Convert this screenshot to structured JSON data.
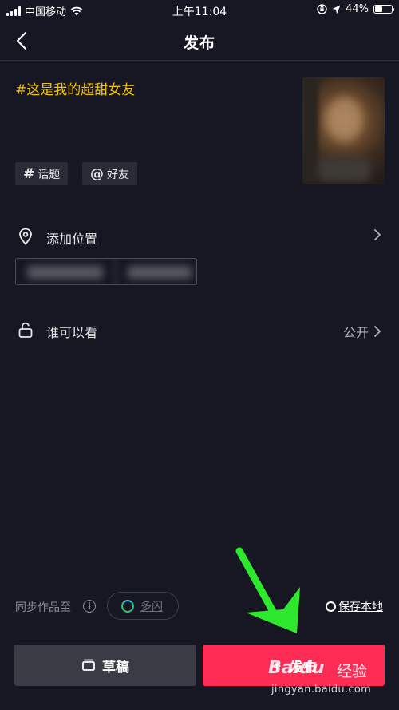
{
  "status_bar": {
    "carrier": "中国移动",
    "time": "上午11:04",
    "battery": "44%",
    "battery_level": 0.44
  },
  "nav": {
    "title": "发布",
    "back_icon": "chevron-left-icon"
  },
  "post": {
    "caption": "#这是我的超甜女友",
    "tags": [
      {
        "symbol": "#",
        "label": "话题"
      },
      {
        "symbol": "@",
        "label": "好友"
      }
    ]
  },
  "location": {
    "label": "添加位置"
  },
  "visibility": {
    "label": "谁可以看",
    "value": "公开"
  },
  "sync": {
    "label": "同步作品至",
    "info_symbol": "i",
    "target_label": "多闪",
    "save_local_label": "保存本地"
  },
  "buttons": {
    "draft": "草稿",
    "publish": "发布"
  },
  "watermark": {
    "logo": "Baidu",
    "brand": "经验",
    "url": "jingyan.baidu.com"
  },
  "colors": {
    "background": "#161722",
    "caption": "#f2c100",
    "publish": "#fe2c55",
    "draft": "#393b45",
    "annotation_arrow": "#2ee82e"
  }
}
